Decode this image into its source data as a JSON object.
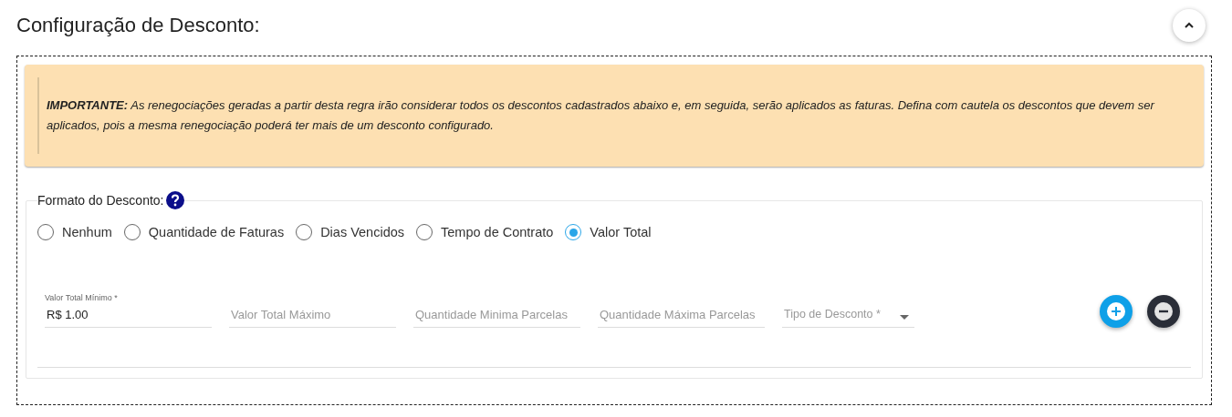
{
  "title": "Configuração de Desconto:",
  "warning": {
    "text": "**IMPORTANTE:** As renegociações geradas a partir desta regra irão considerar todos os descontos cadastrados abaixo e, em seguida, serão aplicados as faturas. Defina com cautela os descontos que devem ser aplicados, pois a mesma renegociação poderá ter mais de um desconto configurado."
  },
  "format": {
    "legend": "Formato do Desconto:",
    "options": [
      {
        "label": "Nenhum",
        "selected": false
      },
      {
        "label": "Quantidade de Faturas",
        "selected": false
      },
      {
        "label": "Dias Vencidos",
        "selected": false
      },
      {
        "label": "Tempo de Contrato",
        "selected": false
      },
      {
        "label": "Valor Total",
        "selected": true
      }
    ]
  },
  "fields": [
    {
      "kind": "text",
      "label": "Valor Total Mínimo *",
      "value": "R$ 1.00"
    },
    {
      "kind": "text",
      "placeholder": "Valor Total Máximo"
    },
    {
      "kind": "text",
      "placeholder": "Quantidade Minima Parcelas"
    },
    {
      "kind": "text",
      "placeholder": "Quantidade Máxima Parcelas"
    },
    {
      "kind": "select",
      "placeholder": "Tipo de Desconto *"
    }
  ]
}
